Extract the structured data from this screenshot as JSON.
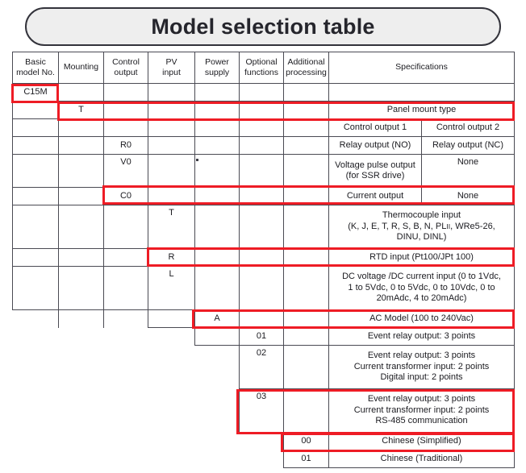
{
  "title": {
    "text": "Model selection table"
  },
  "table": {
    "headers": [
      "Basic\nmodel No.",
      "Mounting",
      "Control\noutput",
      "PV\ninput",
      "Power\nsupply",
      "Optional\nfunctions",
      "Additional\nprocessing",
      "Specifications"
    ],
    "headers_flat": {
      "basic_model_no": "Basic model No.",
      "basic_model_no_l1": "Basic",
      "basic_model_no_l2": "model No.",
      "mounting": "Mounting",
      "control_output_l1": "Control",
      "control_output_l2": "output",
      "pv_input_l1": "PV",
      "pv_input_l2": "input",
      "power_supply_l1": "Power",
      "power_supply_l2": "supply",
      "optional_functions_l1": "Optional",
      "optional_functions_l2": "functions",
      "additional_processing_l1": "Additional",
      "additional_processing_l2": "processing",
      "specifications": "Specifications"
    },
    "rows": [
      {
        "id": "row-c15m",
        "code": "C15M",
        "code_column": "basic-model-no",
        "spec": "",
        "spec2": "",
        "highlighted": true,
        "highlight_start_column": 1
      },
      {
        "id": "row-t-mounting",
        "code": "T",
        "code_column": "mounting",
        "spec": "Panel mount type",
        "spec2": "",
        "highlighted": true,
        "highlight_start_column": 2
      },
      {
        "id": "row-control-output-headers",
        "code": "",
        "code_column": "control-output",
        "spec": "Control output 1",
        "spec2": "Control output 2",
        "highlighted": false
      },
      {
        "id": "row-r0",
        "code": "R0",
        "code_column": "control-output",
        "spec": "Relay output (NO)",
        "spec2": "Relay output (NC)",
        "highlighted": false
      },
      {
        "id": "row-v0",
        "code": "V0",
        "code_column": "control-output",
        "spec_l1": "Voltage pulse output",
        "spec_l2": "(for SSR drive)",
        "spec2": "None",
        "highlighted": false
      },
      {
        "id": "row-c0",
        "code": "C0",
        "code_column": "control-output",
        "spec": "Current output",
        "spec2": "None",
        "highlighted": true,
        "highlight_start_column": 3
      },
      {
        "id": "row-t-pv",
        "code": "T",
        "code_column": "pv-input",
        "spec_l1": "Thermocouple input",
        "spec_l2_a": "(K, J, E, T, R, S, B, N, PL",
        "spec_l2_sc": "II",
        "spec_l2_b": ", WRe5-26,",
        "spec_l3": "DINU, DINL)",
        "highlighted": false
      },
      {
        "id": "row-r-pv",
        "code": "R",
        "code_column": "pv-input",
        "spec": "RTD input (Pt100/JPt 100)",
        "highlighted": true,
        "highlight_start_column": 4
      },
      {
        "id": "row-l-pv",
        "code": "L",
        "code_column": "pv-input",
        "spec_l1": "DC voltage /DC current input (0 to 1Vdc,",
        "spec_l2": "1 to 5Vdc, 0 to 5Vdc, 0 to 10Vdc, 0 to",
        "spec_l3": "20mAdc, 4 to 20mAdc)",
        "highlighted": false
      },
      {
        "id": "row-a-power",
        "code": "A",
        "code_column": "power-supply",
        "spec": "AC Model (100 to 240Vac)",
        "highlighted": true,
        "highlight_start_column": 5
      },
      {
        "id": "row-01-optional",
        "code": "01",
        "code_column": "optional-functions",
        "spec": "Event relay output: 3 points",
        "highlighted": false
      },
      {
        "id": "row-02-optional",
        "code": "02",
        "code_column": "optional-functions",
        "spec_l1": "Event relay output: 3 points",
        "spec_l2": "Current transformer input: 2 points",
        "spec_l3": "Digital input: 2 points",
        "highlighted": false
      },
      {
        "id": "row-03-optional",
        "code": "03",
        "code_column": "optional-functions",
        "spec_l1": "Event relay output: 3 points",
        "spec_l2": "Current transformer input: 2 points",
        "spec_l3": "RS-485 communication",
        "highlighted": true,
        "highlight_start_column": 6
      },
      {
        "id": "row-00-additional",
        "code": "00",
        "code_column": "additional-processing",
        "spec": "Chinese (Simplified)",
        "highlighted": true,
        "highlight_start_column": 7
      },
      {
        "id": "row-01-additional",
        "code": "01",
        "code_column": "additional-processing",
        "spec": "Chinese (Traditional)",
        "highlighted": false
      }
    ]
  },
  "colors": {
    "highlight": "#ee1c25",
    "border": "#4a4a53",
    "title_fill": "#eeeeee",
    "title_border": "#33333b",
    "text": "#1b1b20"
  }
}
